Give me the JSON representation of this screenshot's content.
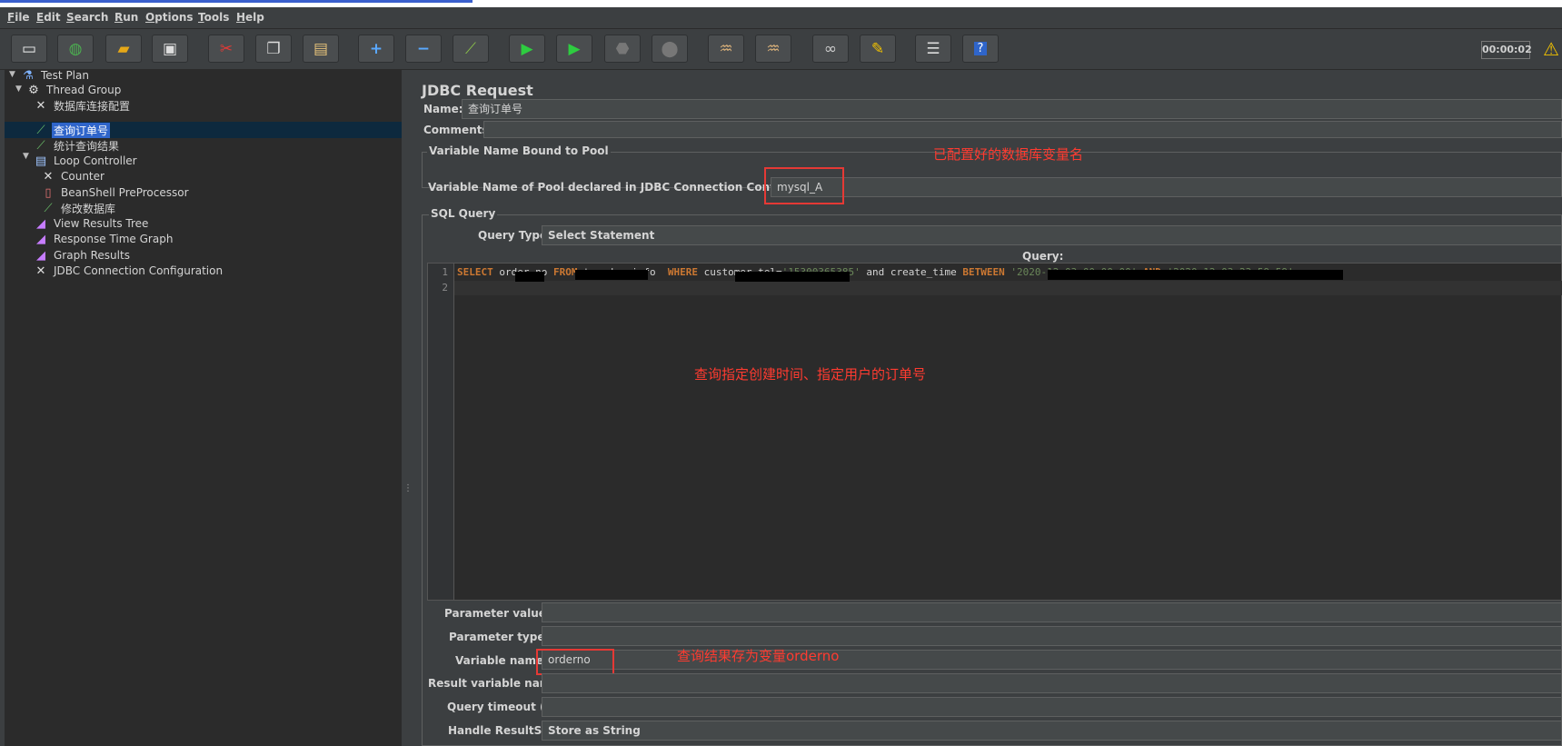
{
  "menu": [
    "File",
    "Edit",
    "Search",
    "Run",
    "Options",
    "Tools",
    "Help"
  ],
  "toolbar": {
    "buttons": [
      {
        "name": "new-icon",
        "glyph": "📄"
      },
      {
        "name": "templates-icon",
        "glyph": "🌐"
      },
      {
        "name": "open-icon",
        "glyph": "📂"
      },
      {
        "name": "save-icon",
        "glyph": "💾"
      },
      {
        "name": "cut-icon",
        "glyph": "✂"
      },
      {
        "name": "copy-icon",
        "glyph": "❐"
      },
      {
        "name": "paste-icon",
        "glyph": "📋"
      },
      {
        "name": "expand-icon",
        "glyph": "+"
      },
      {
        "name": "collapse-icon",
        "glyph": "−"
      },
      {
        "name": "toggle-icon",
        "glyph": "⚡"
      },
      {
        "name": "start-icon",
        "glyph": "▶"
      },
      {
        "name": "start-no-pauses-icon",
        "glyph": "▶"
      },
      {
        "name": "stop-icon",
        "glyph": "⬣"
      },
      {
        "name": "shutdown-icon",
        "glyph": "⬤"
      },
      {
        "name": "clear-icon",
        "glyph": "🧹"
      },
      {
        "name": "clear-all-icon",
        "glyph": "🧹"
      },
      {
        "name": "search-icon",
        "glyph": "🔭"
      },
      {
        "name": "reset-search-icon",
        "glyph": "🧽"
      },
      {
        "name": "function-helper-icon",
        "glyph": "☰"
      },
      {
        "name": "help-icon",
        "glyph": "?"
      }
    ],
    "timer": "00:00:02"
  },
  "tree": {
    "items": [
      {
        "label": "Test Plan",
        "icon": "flask-icon"
      },
      {
        "label": "Thread Group",
        "icon": "gear-icon"
      },
      {
        "label": "数据库连接配置",
        "icon": "wrench-icon"
      },
      {
        "label": "查询订单号",
        "icon": "pipette-icon"
      },
      {
        "label": "统计查询结果",
        "icon": "pipette-icon"
      },
      {
        "label": "Loop Controller",
        "icon": "controller-icon"
      },
      {
        "label": "Counter",
        "icon": "wrench-icon"
      },
      {
        "label": "BeanShell PreProcessor",
        "icon": "script-icon"
      },
      {
        "label": "修改数据库",
        "icon": "pipette-icon"
      },
      {
        "label": "View Results Tree",
        "icon": "chart-icon"
      },
      {
        "label": "Response Time Graph",
        "icon": "chart-icon"
      },
      {
        "label": "Graph Results",
        "icon": "chart-icon"
      },
      {
        "label": "JDBC Connection Configuration",
        "icon": "wrench-icon"
      }
    ]
  },
  "panel": {
    "title": "JDBC Request",
    "name_label": "Name:",
    "name_value": "查询订单号",
    "comments_label": "Comments:",
    "pool_group_title": "Variable Name Bound to Pool",
    "pool_label": "Variable Name of Pool declared in JDBC Connection Configuration:",
    "pool_value": "mysql_A",
    "sql_group_title": "SQL Query",
    "query_type_label": "Query Type:",
    "query_type_value": "Select Statement",
    "query_label": "Query:",
    "line_numbers": [
      "1",
      "2"
    ],
    "code": {
      "t1": "SELECT",
      "t2": " order_no ",
      "t3": "FROM",
      "t4": " t_order_info  ",
      "t5": "WHERE",
      "t6": " customer_tel=",
      "t7": "'15300365385'",
      "t8": " and create_time ",
      "t9": "BETWEEN",
      "t10": " ",
      "t11": "'2020-12-03 00:00:00'",
      "t12": " ",
      "t13": "AND",
      "t14": " ",
      "t15": "'2020-12-03 23:59:59'"
    },
    "param_values_label": "Parameter values:",
    "param_types_label": "Parameter types:",
    "var_names_label": "Variable names:",
    "var_names_value": "orderno",
    "result_var_label": "Result variable name:",
    "timeout_label": "Query timeout (s):",
    "handle_label": "Handle ResultSet:",
    "handle_value": "Store as String"
  },
  "annotations": {
    "pool_note": "已配置好的数据库变量名",
    "query_note": "查询指定创建时间、指定用户的订单号",
    "var_note": "查询结果存为变量orderno"
  }
}
